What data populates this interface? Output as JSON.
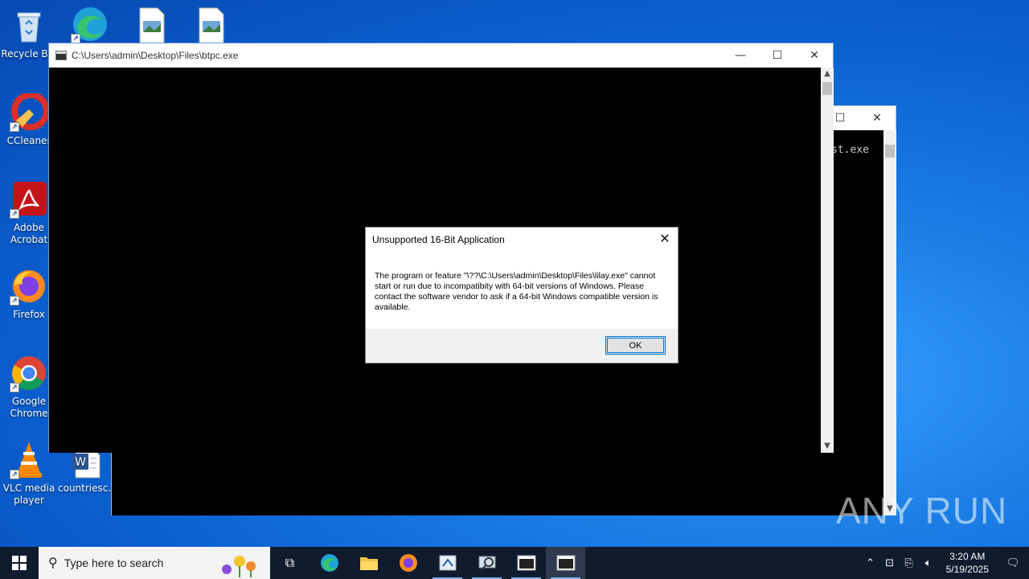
{
  "desktop": {
    "icons": [
      {
        "label": "Recycle Bin"
      },
      {
        "label": "CCleaner"
      },
      {
        "label": "Adobe Acrobat"
      },
      {
        "label": "Firefox"
      },
      {
        "label": "Google Chrome"
      },
      {
        "label": "VLC media player"
      },
      {
        "label": "countriesc..."
      }
    ]
  },
  "back_window": {
    "console_text": "st.exe"
  },
  "main_window": {
    "title": "C:\\Users\\admin\\Desktop\\Files\\btpc.exe"
  },
  "dialog": {
    "title": "Unsupported 16-Bit Application",
    "message": "The program or feature \"\\??\\C:\\Users\\admin\\Desktop\\Files\\lilay.exe\" cannot start or run due to incompatibity with 64-bit versions of Windows. Please contact the software vendor to ask if a 64-bit Windows compatible version is available.",
    "ok_label": "OK"
  },
  "taskbar": {
    "search_placeholder": "Type here to search",
    "time": "3:20 AM",
    "date": "5/19/2025"
  },
  "watermark": "ANY RUN"
}
